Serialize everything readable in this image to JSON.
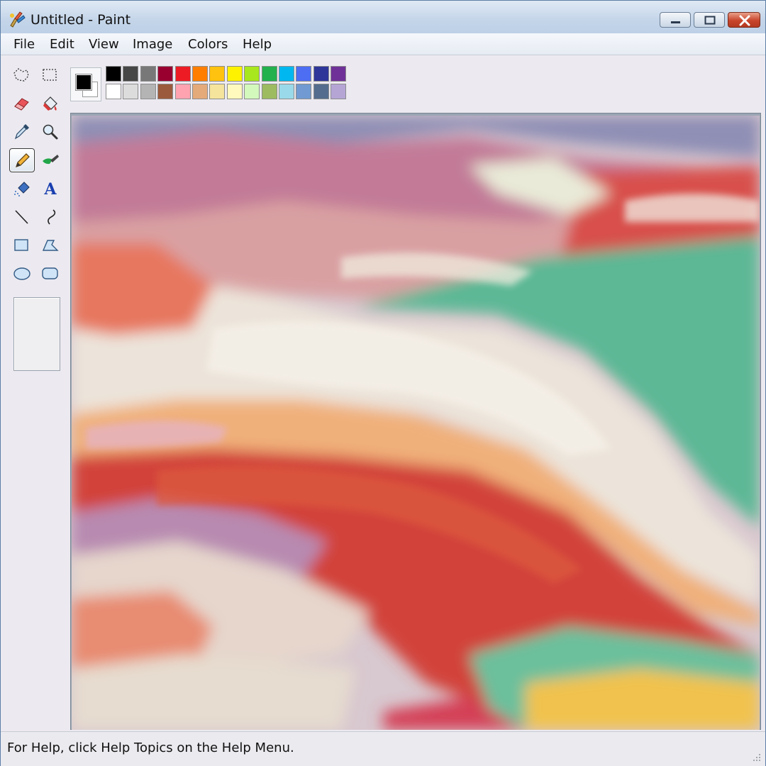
{
  "window": {
    "title": "Untitled - Paint",
    "icon": "paint-palette-icon"
  },
  "window_controls": [
    "minimize-icon",
    "maximize-icon",
    "close-icon"
  ],
  "menu": {
    "items": [
      "File",
      "Edit",
      "View",
      "Image",
      "Colors",
      "Help"
    ]
  },
  "tools": [
    {
      "id": "free-form-select",
      "icon": "free-form-select-icon"
    },
    {
      "id": "rect-select",
      "icon": "rectangle-select-icon"
    },
    {
      "id": "eraser",
      "icon": "eraser-icon"
    },
    {
      "id": "fill",
      "icon": "fill-bucket-icon"
    },
    {
      "id": "pick-color",
      "icon": "eyedropper-icon"
    },
    {
      "id": "magnifier",
      "icon": "magnifier-icon"
    },
    {
      "id": "pencil",
      "icon": "pencil-icon",
      "selected": true
    },
    {
      "id": "brush",
      "icon": "brush-icon"
    },
    {
      "id": "airbrush",
      "icon": "airbrush-icon"
    },
    {
      "id": "text",
      "icon": "text-icon",
      "glyph": "A"
    },
    {
      "id": "line",
      "icon": "line-icon"
    },
    {
      "id": "curve",
      "icon": "curve-icon"
    },
    {
      "id": "rectangle",
      "icon": "rectangle-icon"
    },
    {
      "id": "polygon",
      "icon": "polygon-icon"
    },
    {
      "id": "ellipse",
      "icon": "ellipse-icon"
    },
    {
      "id": "rounded-rectangle",
      "icon": "rounded-rectangle-icon"
    }
  ],
  "colors": {
    "foreground": "#000000",
    "background": "#ffffff",
    "palette_top": [
      "#000000",
      "#464646",
      "#787878",
      "#990030",
      "#ed1c24",
      "#ff7e00",
      "#ffc20e",
      "#fff200",
      "#a8e61d",
      "#22b14c",
      "#00b7ef",
      "#4d6df3",
      "#2f3699",
      "#6f3198"
    ],
    "palette_bottom": [
      "#ffffff",
      "#dcdcdc",
      "#b4b4b4",
      "#9c5a3c",
      "#ffa3b1",
      "#e5aa7a",
      "#f5e49c",
      "#fff9bd",
      "#d3f9bc",
      "#9dbb61",
      "#99d9ea",
      "#709ad1",
      "#546d8e",
      "#b5a5d5"
    ]
  },
  "status": {
    "text": "For Help, click Help Topics on the Help Menu."
  }
}
